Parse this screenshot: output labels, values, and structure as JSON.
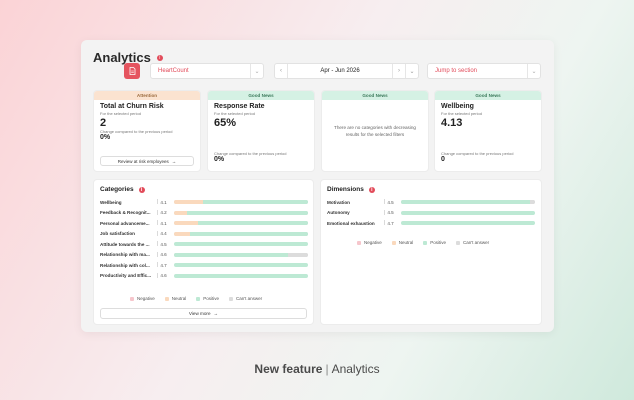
{
  "page": {
    "title": "Analytics"
  },
  "toolbar": {
    "company_value": "HeartCount",
    "date_value": "Apr - Jun 2026",
    "jump_placeholder": "Jump to section"
  },
  "kpis": [
    {
      "badge": "Attention",
      "title": "Total at Churn Risk",
      "subtitle": "For the selected period",
      "value": "2",
      "change_label": "Change compared to the previous period",
      "change_value": "0%",
      "button": "Review at risk employees"
    },
    {
      "badge": "Good News",
      "title": "Response Rate",
      "subtitle": "For the selected period",
      "value": "65%",
      "change_label": "Change compared to the previous period",
      "change_value": "0%"
    },
    {
      "badge": "Good News",
      "message": "There are no categories with decreasing results for the selected filters"
    },
    {
      "badge": "Good News",
      "title": "Wellbeing",
      "subtitle": "For the selected period",
      "value": "4.13",
      "change_label": "Change compared to the previous period",
      "change_value": "0"
    }
  ],
  "categories": {
    "title": "Categories",
    "rows": [
      {
        "label": "Wellbeing",
        "score": "4.1",
        "neg": 0,
        "neu": 0.22,
        "pos": 0.78,
        "na": 0
      },
      {
        "label": "Feedback & Recognit...",
        "score": "4.2",
        "neg": 0,
        "neu": 0.1,
        "pos": 0.9,
        "na": 0
      },
      {
        "label": "Personal advanceme...",
        "score": "4.1",
        "neg": 0,
        "neu": 0.18,
        "pos": 0.82,
        "na": 0
      },
      {
        "label": "Job satisfaction",
        "score": "4.4",
        "neg": 0,
        "neu": 0.12,
        "pos": 0.88,
        "na": 0
      },
      {
        "label": "Attitude towards the ...",
        "score": "4.5",
        "neg": 0,
        "neu": 0.0,
        "pos": 1.0,
        "na": 0
      },
      {
        "label": "Relationship with ma...",
        "score": "4.6",
        "neg": 0,
        "neu": 0.0,
        "pos": 0.85,
        "na": 0.15
      },
      {
        "label": "Relationship with col...",
        "score": "4.7",
        "neg": 0,
        "neu": 0.0,
        "pos": 1.0,
        "na": 0
      },
      {
        "label": "Productivity and Effic...",
        "score": "4.6",
        "neg": 0,
        "neu": 0.0,
        "pos": 1.0,
        "na": 0
      }
    ],
    "view_more": "View more"
  },
  "dimensions": {
    "title": "Dimensions",
    "rows": [
      {
        "label": "Motivation",
        "score": "4.5",
        "neg": 0,
        "neu": 0,
        "pos": 0.96,
        "na": 0.04
      },
      {
        "label": "Autonomy",
        "score": "4.5",
        "neg": 0,
        "neu": 0,
        "pos": 1.0,
        "na": 0
      },
      {
        "label": "Emotional exhaustion",
        "score": "4.7",
        "neg": 0,
        "neu": 0,
        "pos": 1.0,
        "na": 0
      }
    ]
  },
  "legend": [
    "Negative",
    "Neutral",
    "Positive",
    "Can't answer"
  ],
  "colors": {
    "negative": "#f6c6cc",
    "neutral": "#fad9bd",
    "positive": "#bde9d4",
    "na": "#dcdcdc",
    "accent": "#e5545f"
  },
  "footer": {
    "bold": "New feature",
    "rest": "Analytics"
  }
}
